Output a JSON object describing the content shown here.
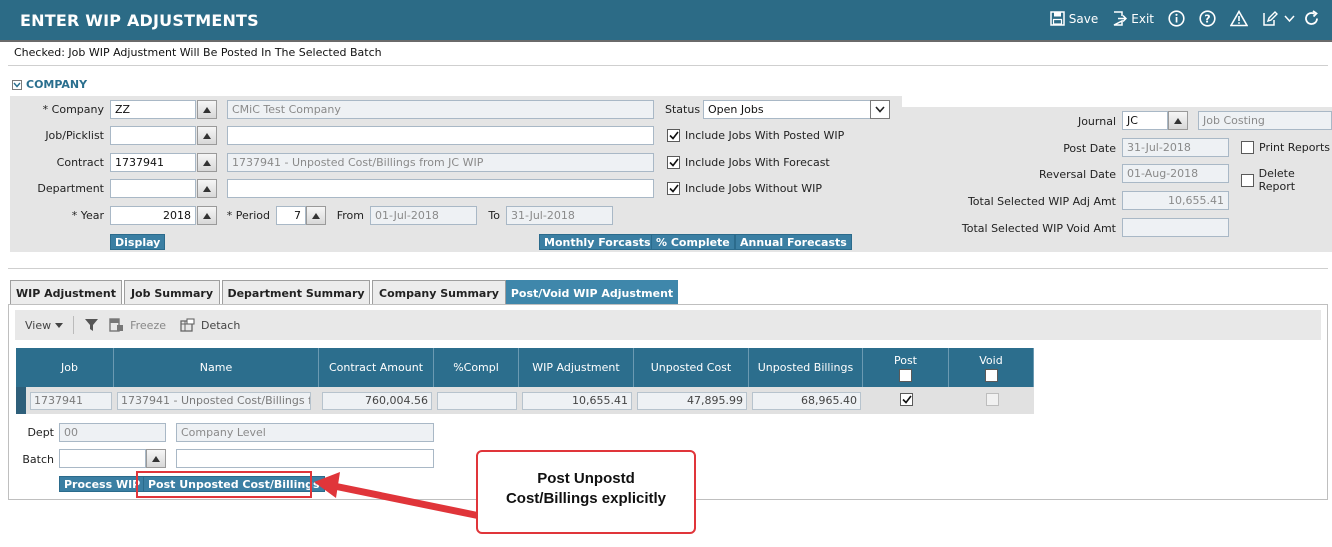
{
  "app": {
    "title": "ENTER WIP ADJUSTMENTS",
    "actions": {
      "save": "Save",
      "exit": "Exit"
    },
    "message": "Checked: Job WIP Adjustment Will Be Posted In The Selected Batch"
  },
  "company_section": {
    "title": "COMPANY",
    "company": {
      "label": "* Company",
      "code": "ZZ",
      "name": "CMiC Test Company"
    },
    "job_picklist": {
      "label": "Job/Picklist",
      "code": "",
      "name": ""
    },
    "contract": {
      "label": "Contract",
      "code": "1737941",
      "name": "1737941 - Unposted Cost/Billings from JC WIP"
    },
    "department": {
      "label": "Department",
      "code": "",
      "name": ""
    },
    "year": {
      "label": "* Year",
      "value": "2018"
    },
    "period": {
      "label": "* Period",
      "value": "7"
    },
    "from": {
      "label": "From",
      "value": "01-Jul-2018"
    },
    "to": {
      "label": "To",
      "value": "31-Jul-2018"
    },
    "status": {
      "label": "Status",
      "value": "Open Jobs"
    },
    "checkboxes": [
      {
        "label": "Include Jobs With Posted WIP",
        "checked": true
      },
      {
        "label": "Include Jobs With Forecast",
        "checked": true
      },
      {
        "label": "Include Jobs Without WIP",
        "checked": true
      }
    ],
    "buttons": {
      "display": "Display",
      "monthly": "Monthly Forcasts",
      "complete": "% Complete",
      "annual": "Annual Forecasts"
    }
  },
  "journal_section": {
    "journal": {
      "label": "Journal",
      "code": "JC",
      "name": "Job Costing"
    },
    "post_date": {
      "label": "Post Date",
      "value": "31-Jul-2018"
    },
    "reversal_date": {
      "label": "Reversal Date",
      "value": "01-Aug-2018"
    },
    "total_adj": {
      "label": "Total Selected WIP Adj Amt",
      "value": "10,655.41"
    },
    "total_void": {
      "label": "Total Selected WIP Void Amt",
      "value": ""
    },
    "print_reports": {
      "label": "Print Reports",
      "checked": false
    },
    "delete_report": {
      "label": "Delete Report",
      "checked": false
    }
  },
  "tabs": [
    {
      "label": "WIP Adjustment",
      "active": false
    },
    {
      "label": "Job Summary",
      "active": false
    },
    {
      "label": "Department Summary",
      "active": false
    },
    {
      "label": "Company Summary",
      "active": false
    },
    {
      "label": "Post/Void WIP Adjustment",
      "active": true
    }
  ],
  "toolbar": {
    "view": "View",
    "freeze": "Freeze",
    "detach": "Detach"
  },
  "grid": {
    "columns": [
      "Job",
      "Name",
      "Contract Amount",
      "%Compl",
      "WIP Adjustment",
      "Unposted Cost",
      "Unposted Billings",
      "Post",
      "Void"
    ],
    "rows": [
      {
        "job": "1737941",
        "name": "1737941 - Unposted Cost/Billings fr",
        "contract_amount": "760,004.56",
        "compl": "",
        "wip_adjustment": "10,655.41",
        "unposted_cost": "47,895.99",
        "unposted_billings": "68,965.40",
        "post": true,
        "void": false
      }
    ]
  },
  "bottom": {
    "dept": {
      "label": "Dept",
      "code": "00",
      "name": "Company Level"
    },
    "batch": {
      "label": "Batch",
      "code": "",
      "name": ""
    },
    "buttons": {
      "process": "Process WIP",
      "post_unposted": "Post Unposted Cost/Billings"
    }
  },
  "annotation": {
    "line1": "Post Unpostd",
    "line2": "Cost/Billings explicitly",
    "color": "#e0353a"
  }
}
